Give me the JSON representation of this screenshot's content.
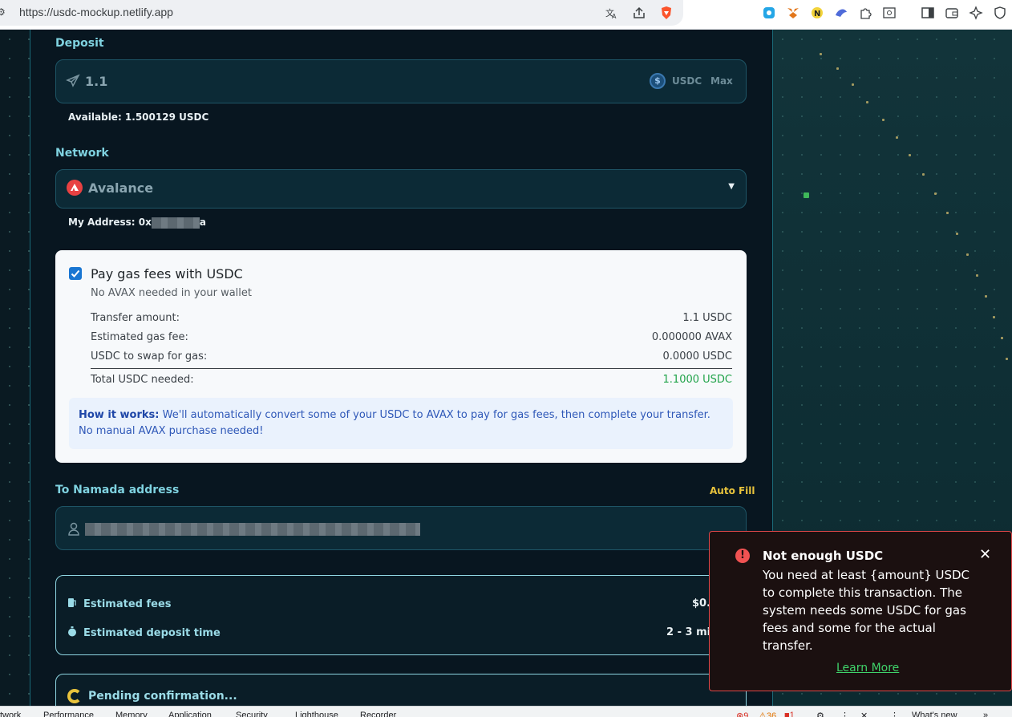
{
  "browser": {
    "url": "https://usdc-mockup.netlify.app"
  },
  "deposit": {
    "label": "Deposit",
    "amount": "1.1",
    "token": "USDC",
    "max_label": "Max",
    "available": "Available: 1.500129 USDC"
  },
  "network": {
    "label": "Network",
    "selected": "Avalance",
    "address_prefix": "My Address: 0x",
    "address_suffix": "a"
  },
  "gas": {
    "checked": true,
    "title": "Pay gas fees with USDC",
    "subtitle": "No AVAX needed in your wallet",
    "rows": [
      {
        "label": "Transfer amount:",
        "value": "1.1 USDC"
      },
      {
        "label": "Estimated gas fee:",
        "value": "0.000000 AVAX"
      },
      {
        "label": "USDC to swap for gas:",
        "value": "0.0000 USDC"
      }
    ],
    "total_label": "Total USDC needed:",
    "total_value": "1.1000 USDC",
    "how_title": "How it works:",
    "how_text": " We'll automatically convert some of your USDC to AVAX to pay for gas fees, then complete your transfer. No manual AVAX purchase needed!"
  },
  "namada": {
    "label": "To Namada address",
    "autofill_label": "Auto Fill"
  },
  "fees": {
    "fee_label": "Estimated fees",
    "fee_value": "$0.0",
    "time_label": "Estimated deposit time",
    "time_value": "2 - 3 min"
  },
  "pending": {
    "label": "Pending confirmation..."
  },
  "toast": {
    "title": "Not enough USDC",
    "message": "You need at least {amount} USDC to complete this transaction. The system needs some USDC for gas fees and some for the actual transfer.",
    "link": "Learn More",
    "close": "✕"
  },
  "devtools": {
    "tabs": [
      "twork",
      "Performance",
      "Memory",
      "Application",
      "Security",
      "Lighthouse",
      "Recorder"
    ],
    "errors": "9",
    "warnings": "36",
    "info": "1",
    "whats_new": "What's new"
  },
  "colors": {
    "accent": "#7fd2e0",
    "success": "#21a34a",
    "error": "#e0484a",
    "autofill": "#e8c33c"
  }
}
